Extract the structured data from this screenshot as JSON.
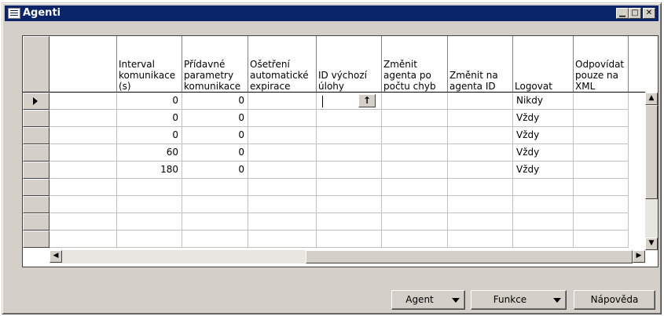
{
  "window": {
    "title": "Agenti"
  },
  "columns": [
    {
      "label": "",
      "align": "left"
    },
    {
      "label": "Interval komunikace (s)",
      "align": "right"
    },
    {
      "label": "Přídavné parametry komunikace",
      "align": "right"
    },
    {
      "label": "Ošetření automatické expirace",
      "align": "left"
    },
    {
      "label": "ID výchozí úlohy",
      "align": "left"
    },
    {
      "label": "Změnit agenta po počtu chyb",
      "align": "left"
    },
    {
      "label": "Změnit na agenta ID",
      "align": "left"
    },
    {
      "label": "Logovat",
      "align": "left"
    },
    {
      "label": "Odpovídat pouze na XML",
      "align": "left"
    }
  ],
  "rows": [
    [
      "",
      "0",
      "0",
      "",
      "",
      "",
      "",
      "Nikdy",
      ""
    ],
    [
      "",
      "0",
      "0",
      "",
      "",
      "",
      "",
      "Vždy",
      ""
    ],
    [
      "",
      "0",
      "0",
      "",
      "",
      "",
      "",
      "Vždy",
      ""
    ],
    [
      "",
      "60",
      "0",
      "",
      "",
      "",
      "",
      "Vždy",
      ""
    ],
    [
      "",
      "180",
      "0",
      "",
      "",
      "",
      "",
      "Vždy",
      ""
    ],
    [
      "",
      "",
      "",
      "",
      "",
      "",
      "",
      "",
      ""
    ],
    [
      "",
      "",
      "",
      "",
      "",
      "",
      "",
      "",
      ""
    ],
    [
      "",
      "",
      "",
      "",
      "",
      "",
      "",
      "",
      ""
    ],
    [
      "",
      "",
      "",
      "",
      "",
      "",
      "",
      "",
      ""
    ]
  ],
  "buttons": {
    "agent": "Agent",
    "funkce": "Funkce",
    "napoveda": "Nápověda"
  },
  "icons": {
    "lookup": "up-arrow-icon",
    "minimize": "minimize-icon",
    "maximize": "maximize-icon",
    "close": "close-icon"
  }
}
